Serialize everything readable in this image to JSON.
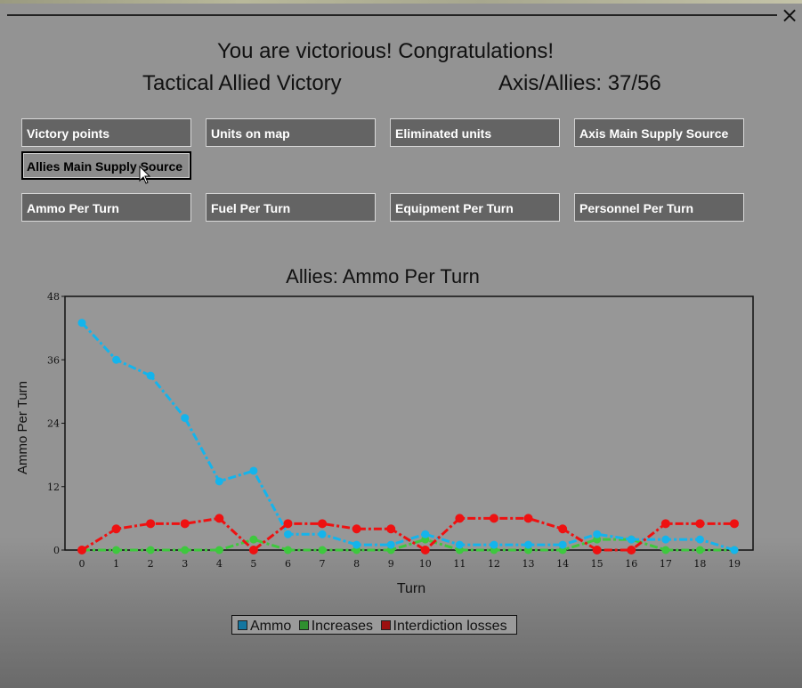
{
  "window": {
    "headline": "You are victorious! Congratulations!",
    "victory_type": "Tactical Allied Victory",
    "score": "Axis/Allies: 37/56",
    "close_icon": "close-icon"
  },
  "buttons": {
    "row1": [
      "Victory points",
      "Units on map",
      "Eliminated units",
      "Axis Main Supply Source"
    ],
    "row2": [
      "Allies Main Supply Source"
    ],
    "row3": [
      "Ammo Per Turn",
      "Fuel Per Turn",
      "Equipment Per Turn",
      "Personnel Per Turn"
    ],
    "active": "Allies Main Supply Source"
  },
  "colors": {
    "ammo": "#14b4ec",
    "increases": "#3ec83e",
    "interdiction": "#ee1111",
    "plot_bg": "#979797",
    "legend_ammo": "#1476a0",
    "legend_increases": "#2f8f2f",
    "legend_interdiction": "#9c1010"
  },
  "chart_data": {
    "type": "line",
    "title": "Allies: Ammo Per Turn",
    "xlabel": "Turn",
    "ylabel": "Ammo Per Turn",
    "x": [
      0,
      1,
      2,
      3,
      4,
      5,
      6,
      7,
      8,
      9,
      10,
      11,
      12,
      13,
      14,
      15,
      16,
      17,
      18,
      19
    ],
    "ylim": [
      0,
      48
    ],
    "yticks": [
      0,
      12,
      24,
      36,
      48
    ],
    "grid": false,
    "legend_position": "bottom",
    "series": [
      {
        "name": "Ammo",
        "values": [
          43,
          36,
          33,
          25,
          13,
          15,
          3,
          3,
          1,
          1,
          3,
          1,
          1,
          1,
          1,
          3,
          2,
          2,
          2,
          0
        ]
      },
      {
        "name": "Increases",
        "values": [
          0,
          0,
          0,
          0,
          0,
          2,
          0,
          0,
          0,
          0,
          2,
          0,
          0,
          0,
          0,
          2,
          2,
          0,
          0,
          0
        ]
      },
      {
        "name": "Interdiction losses",
        "values": [
          0,
          4,
          5,
          5,
          6,
          0,
          5,
          5,
          4,
          4,
          0,
          6,
          6,
          6,
          4,
          0,
          0,
          5,
          5,
          5
        ]
      }
    ]
  }
}
